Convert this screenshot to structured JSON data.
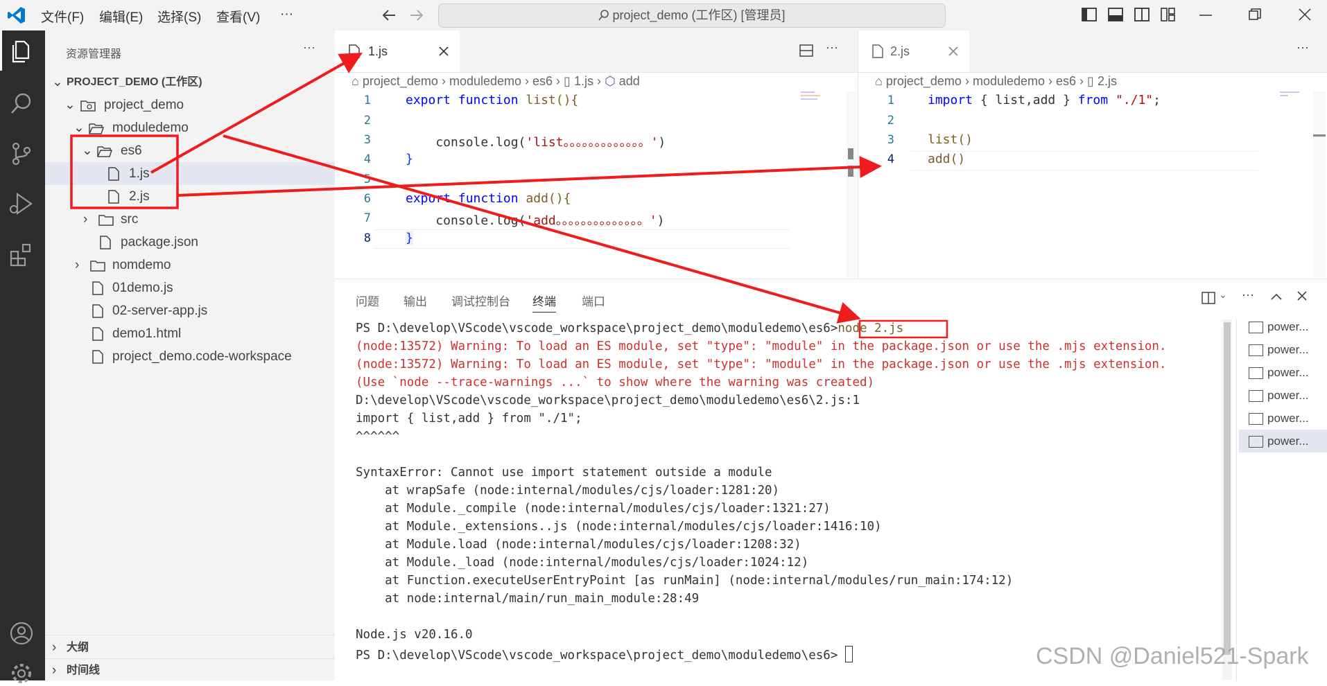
{
  "menu": {
    "file": "文件(F)",
    "edit": "编辑(E)",
    "select": "选择(S)",
    "view": "查看(V)",
    "more": "···"
  },
  "title": {
    "command_center": "project_demo (工作区) [管理员]"
  },
  "sidebar": {
    "title": "资源管理器",
    "more": "···",
    "workspace": "PROJECT_DEMO (工作区)",
    "items": [
      {
        "label": "project_demo"
      },
      {
        "label": "moduledemo"
      },
      {
        "label": "es6"
      },
      {
        "label": "1.js"
      },
      {
        "label": "2.js"
      },
      {
        "label": "src"
      },
      {
        "label": "package.json"
      },
      {
        "label": "nomdemo"
      },
      {
        "label": "01demo.js"
      },
      {
        "label": "02-server-app.js"
      },
      {
        "label": "demo1.html"
      },
      {
        "label": "project_demo.code-workspace"
      }
    ],
    "outline": "大纲",
    "timeline": "时间线"
  },
  "editor1": {
    "tab": "1.js",
    "crumbs": [
      "project_demo",
      "moduledemo",
      "es6",
      "1.js",
      "add"
    ],
    "line_numbers": [
      "1",
      "2",
      "3",
      "4",
      "5",
      "6",
      "7",
      "8"
    ],
    "code": {
      "l1_kw1": "export",
      "l1_kw2": "function",
      "l1_rest": " list(){",
      "l3_a": "    console.log(",
      "l3_s": "'list。。。。。。。。。。。。。'",
      "l3_b": ")",
      "l4": "}",
      "l6_kw1": "export",
      "l6_kw2": "function",
      "l6_rest": " add(){",
      "l7_a": "    console.log(",
      "l7_s": "'add。。。。。。。。。。。。。。'",
      "l7_b": ")",
      "l8": "}"
    }
  },
  "editor2": {
    "tab": "2.js",
    "crumbs": [
      "project_demo",
      "moduledemo",
      "es6",
      "2.js"
    ],
    "line_numbers": [
      "1",
      "2",
      "3",
      "4"
    ],
    "code": {
      "l1_kw": "import",
      "l1_mid": " { list,add } ",
      "l1_kw2": "from",
      "l1_sp": " ",
      "l1_s": "\"./1\"",
      "l1_end": ";",
      "l3": "list()",
      "l4": "add()"
    }
  },
  "panel": {
    "tabs": [
      "问题",
      "输出",
      "调试控制台",
      "终端",
      "端口"
    ],
    "active_tab": "终端",
    "terminal": {
      "prompt1": "PS D:\\develop\\VScode\\vscode_workspace\\project_demo\\moduledemo\\es6>",
      "cmd1": "node 2.js",
      "warn1": "(node:13572) Warning: To load an ES module, set \"type\": \"module\" in the package.json or use the .mjs extension.",
      "warn2": "(node:13572) Warning: To load an ES module, set \"type\": \"module\" in the package.json or use the .mjs extension.",
      "warn3": "(Use `node --trace-warnings ...` to show where the warning was created)",
      "l4": "D:\\develop\\VScode\\vscode_workspace\\project_demo\\moduledemo\\es6\\2.js:1",
      "l5": "import { list,add } from \"./1\";",
      "l6": "^^^^^^",
      "l8": "SyntaxError: Cannot use import statement outside a module",
      "l9": "    at wrapSafe (node:internal/modules/cjs/loader:1281:20)",
      "l10": "    at Module._compile (node:internal/modules/cjs/loader:1321:27)",
      "l11": "    at Module._extensions..js (node:internal/modules/cjs/loader:1416:10)",
      "l12": "    at Module.load (node:internal/modules/cjs/loader:1208:32)",
      "l13": "    at Module._load (node:internal/modules/cjs/loader:1024:12)",
      "l14": "    at Function.executeUserEntryPoint [as runMain] (node:internal/modules/run_main:174:12)",
      "l15": "    at node:internal/main/run_main_module:28:49",
      "l17": "Node.js v20.16.0",
      "prompt2": "PS D:\\develop\\VScode\\vscode_workspace\\project_demo\\moduledemo\\es6>"
    },
    "terminal_list": [
      "power...",
      "power...",
      "power...",
      "power...",
      "power...",
      "power..."
    ]
  },
  "watermark": "CSDN @Daniel521-Spark",
  "colors": {
    "annotation": "#ee1c1c",
    "keyword": "#0000ff",
    "string": "#a31515",
    "activity_bar": "#2c2c2c"
  }
}
